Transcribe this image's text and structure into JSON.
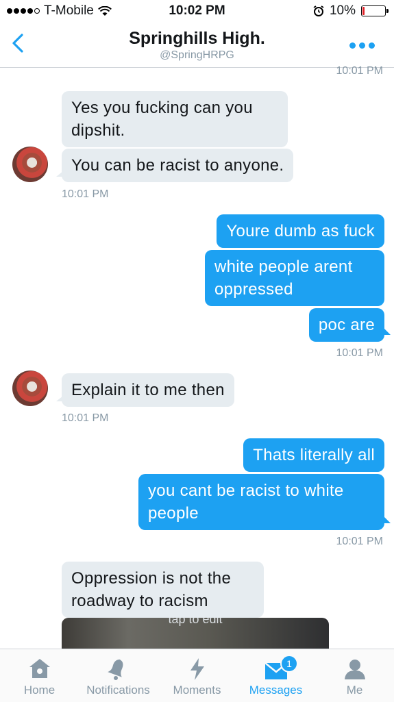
{
  "status_bar": {
    "carrier": "T-Mobile",
    "time": "10:02 PM",
    "battery": "10%",
    "battery_level": 0.1
  },
  "header": {
    "title": "Springhills High.",
    "handle": "@SpringHRPG"
  },
  "messages": {
    "top_timestamp": "10:01 PM",
    "g1": {
      "m1": "Yes you fucking can you dipshit.",
      "m2": "You can be racist to anyone.",
      "ts": "10:01 PM"
    },
    "g2": {
      "m1": "Youre dumb as fuck",
      "m2": "white people arent oppressed",
      "m3": "poc are",
      "ts": "10:01 PM"
    },
    "g3": {
      "m1": "Explain it to me then",
      "ts": "10:01 PM"
    },
    "g4": {
      "m1": "Thats literally all",
      "m2": "you cant be racist to white people",
      "ts": "10:01 PM"
    },
    "g5": {
      "m1": "Oppression is not the roadway to racism"
    },
    "media_label": "tap to edit"
  },
  "tabs": [
    {
      "label": "Home",
      "icon": "home-icon"
    },
    {
      "label": "Notifications",
      "icon": "bell-icon"
    },
    {
      "label": "Moments",
      "icon": "lightning-icon"
    },
    {
      "label": "Messages",
      "icon": "envelope-icon",
      "badge": "1",
      "active": true
    },
    {
      "label": "Me",
      "icon": "person-icon"
    }
  ],
  "colors": {
    "accent": "#1da1f2",
    "incoming_bubble": "#e6ecf0",
    "meta_text": "#8899a6"
  }
}
